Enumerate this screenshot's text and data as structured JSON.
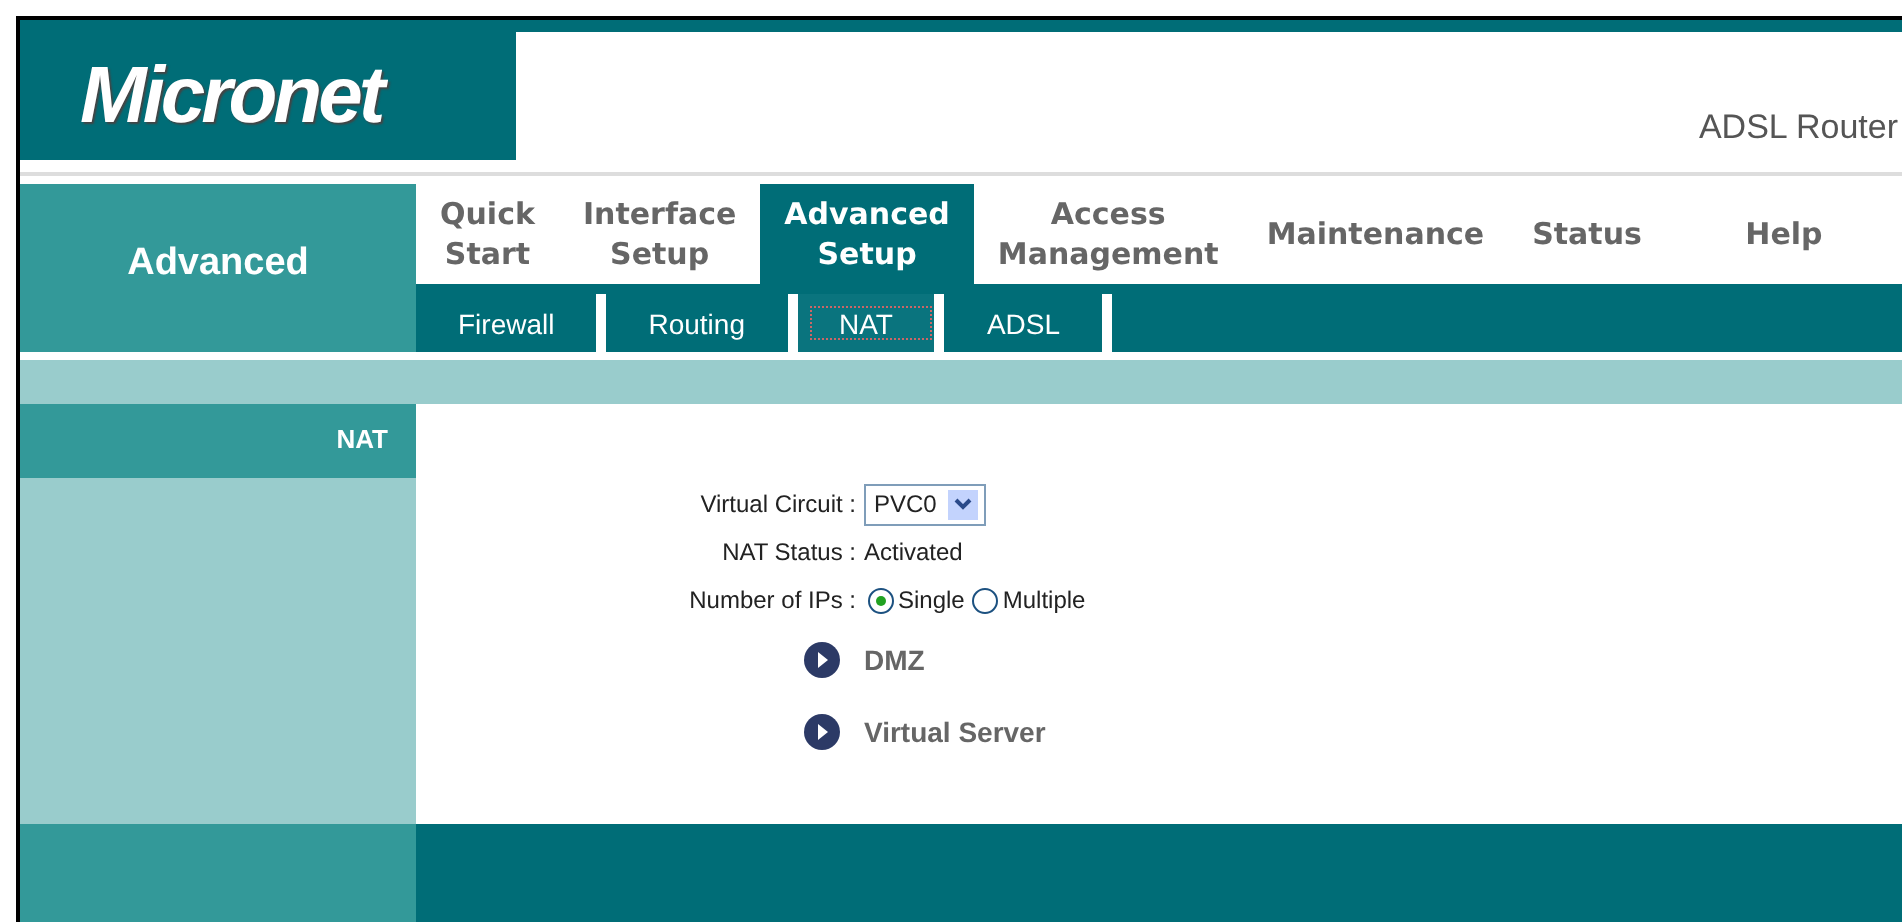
{
  "header": {
    "logo": "Micronet",
    "product": "ADSL Router"
  },
  "section_title": "Advanced",
  "main_tabs": [
    {
      "label": "Quick Start",
      "selected": false
    },
    {
      "label": "Interface Setup",
      "selected": false
    },
    {
      "label": "Advanced Setup",
      "selected": true
    },
    {
      "label": "Access Management",
      "selected": false
    },
    {
      "label": "Maintenance",
      "selected": false
    },
    {
      "label": "Status",
      "selected": false
    },
    {
      "label": "Help",
      "selected": false
    }
  ],
  "sub_tabs": [
    {
      "label": "Firewall",
      "selected": false
    },
    {
      "label": "Routing",
      "selected": false
    },
    {
      "label": "NAT",
      "selected": true
    },
    {
      "label": "ADSL",
      "selected": false
    }
  ],
  "sidebar": {
    "title": "NAT"
  },
  "form": {
    "virtual_circuit": {
      "label": "Virtual Circuit :",
      "value": "PVC0"
    },
    "nat_status": {
      "label": "NAT Status :",
      "value": "Activated"
    },
    "number_of_ips": {
      "label": "Number of IPs :",
      "options": [
        {
          "label": "Single",
          "selected": true
        },
        {
          "label": "Multiple",
          "selected": false
        }
      ]
    }
  },
  "links": [
    "DMZ",
    "Virtual Server"
  ]
}
